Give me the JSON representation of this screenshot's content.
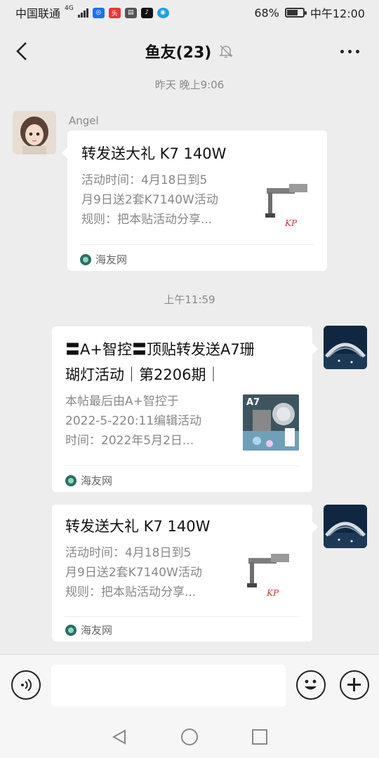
{
  "status_bar": {
    "carrier": "中国联通",
    "network": "4G",
    "battery_percent": "68%",
    "time": "中午12:00",
    "battery_level": 0.68
  },
  "header": {
    "title": "鱼友(23)",
    "back_icon": "chevron-left-icon",
    "mute_icon": "bell-off-icon",
    "more_icon": "more-horizontal-icon"
  },
  "messages": [
    {
      "timestamp": "昨天 晚上9:06",
      "sender": "Angel",
      "side": "left",
      "title": "转发送大礼 K7 140W",
      "desc_lines": [
        "活动时间：4月18日到5",
        "月9日送2套K7140W活动",
        "规则：把本贴活动分享..."
      ],
      "source": "海友网",
      "thumb_label": "KP"
    },
    {
      "timestamp": "上午11:59",
      "side": "right",
      "title_lines": [
        "〓A+智控〓顶贴转发送A7珊",
        "瑚灯活动｜第2206期｜"
      ],
      "desc_lines": [
        "本帖最后由A+智控于",
        "2022-5-220:11编辑活动",
        "时间：2022年5月2日..."
      ],
      "source": "海友网",
      "thumb_label": "A7"
    },
    {
      "side": "right",
      "title": "转发送大礼 K7 140W",
      "desc_lines": [
        "活动时间：4月18日到5",
        "月9日送2套K7140W活动",
        "规则：把本贴活动分享..."
      ],
      "source": "海友网",
      "thumb_label": "KP"
    }
  ],
  "input_bar": {
    "voice_icon": "voice-icon",
    "emoji_icon": "emoji-icon",
    "plus_icon": "plus-icon",
    "placeholder": ""
  },
  "nav_bar": {
    "back_icon": "triangle-back-icon",
    "home_icon": "circle-home-icon",
    "recents_icon": "square-recents-icon"
  }
}
